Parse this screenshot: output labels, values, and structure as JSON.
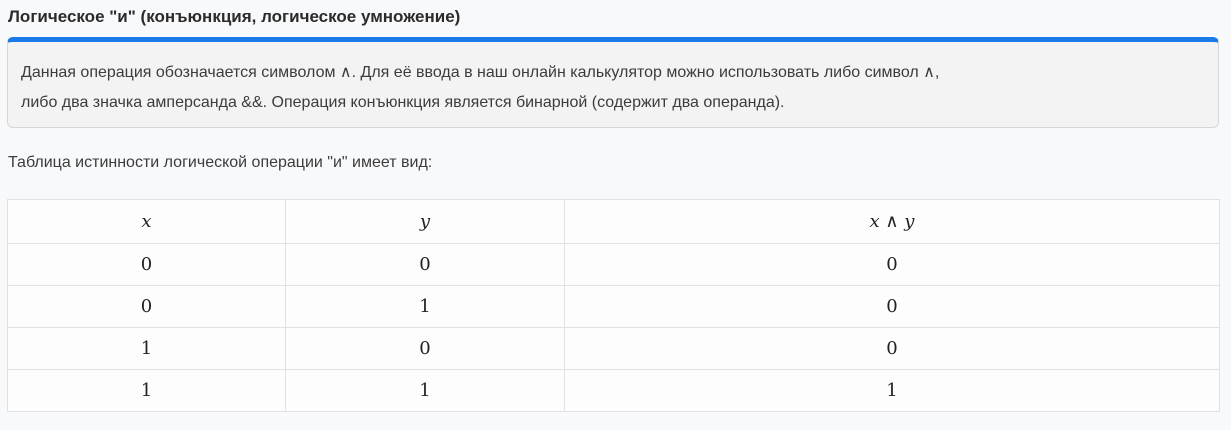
{
  "section": {
    "title": "Логическое \"и\" (конъюнкция, логическое умножение)"
  },
  "info": {
    "line1": "Данная операция обозначается символом ∧. Для её ввода в наш онлайн калькулятор можно использовать либо символ ∧,",
    "line2": "либо два значка амперсанда &&. Операция конъюнкция является бинарной (содержит два операнда)."
  },
  "intro_text": "Таблица истинности логической операции \"и\" имеет вид:",
  "truth_table": {
    "headers": [
      "x",
      "y",
      "x ∧ y"
    ],
    "rows": [
      [
        "0",
        "0",
        "0"
      ],
      [
        "0",
        "1",
        "0"
      ],
      [
        "1",
        "0",
        "0"
      ],
      [
        "1",
        "1",
        "1"
      ]
    ]
  }
}
